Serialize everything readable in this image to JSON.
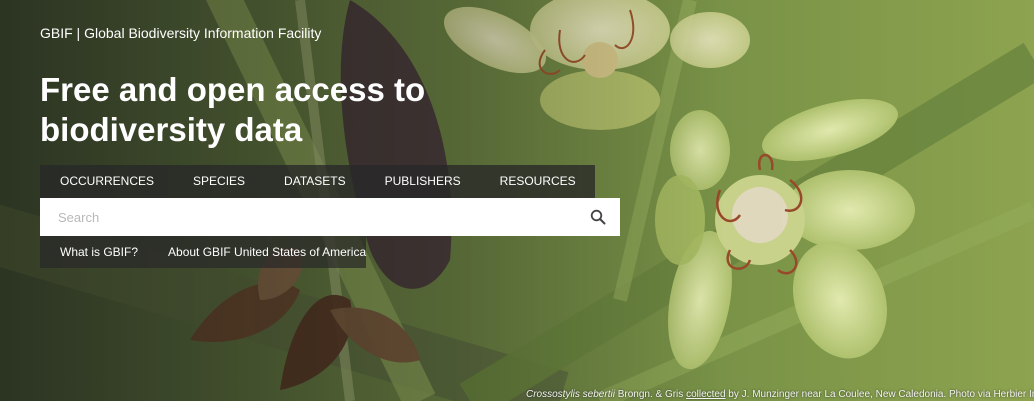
{
  "header": {
    "site_name": "GBIF | Global Biodiversity Information Facility",
    "headline": "Free and open access to biodiversity data"
  },
  "nav": {
    "tabs": [
      {
        "label": "OCCURRENCES"
      },
      {
        "label": "SPECIES"
      },
      {
        "label": "DATASETS"
      },
      {
        "label": "PUBLISHERS"
      },
      {
        "label": "RESOURCES"
      }
    ]
  },
  "search": {
    "placeholder": "Search",
    "value": "",
    "icon": "magnifier-icon"
  },
  "links": {
    "what_is": "What is GBIF?",
    "about": "About GBIF United States of America"
  },
  "caption": {
    "species": "Crossostylis sebertii",
    "authority": " Brongn. & Gris ",
    "collected_link": "collected",
    "rest": " by J. Munzinger near La Coulee, New Caledonia. Photo via Herbier Inst"
  },
  "colors": {
    "bar_bg": "#282828",
    "text": "#ffffff",
    "search_bg": "#ffffff",
    "placeholder": "#b8b8b8"
  }
}
